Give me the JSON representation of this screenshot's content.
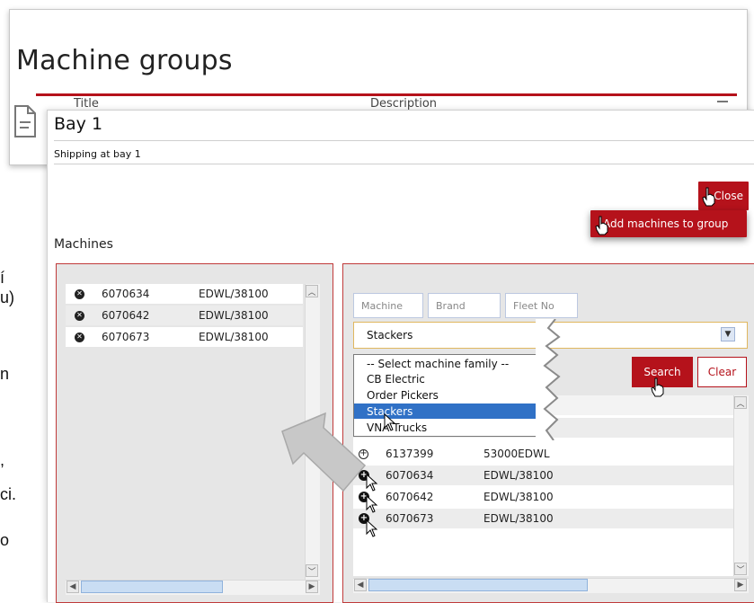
{
  "background_window": {
    "title": "Machine groups",
    "columns": [
      "Title",
      "Description"
    ]
  },
  "edge_fragments": [
    "í",
    "u)",
    "n",
    ",",
    "ci.",
    "o"
  ],
  "dialog": {
    "title": "Bay 1",
    "subtitle": "Shipping at bay 1",
    "close_label": "Close",
    "add_machines_label": "Add machines to group",
    "section_label": "Machines"
  },
  "left_list": {
    "rows": [
      {
        "number": "6070634",
        "model": "EDWL/38100"
      },
      {
        "number": "6070642",
        "model": "EDWL/38100"
      },
      {
        "number": "6070673",
        "model": "EDWL/38100"
      }
    ]
  },
  "filters": {
    "machine_placeholder": "Machine",
    "brand_placeholder": "Brand",
    "fleet_placeholder": "Fleet No"
  },
  "family_select": {
    "selected": "Stackers",
    "options": [
      "-- Select machine family --",
      "CB Electric",
      "Order Pickers",
      "Stackers",
      "VNA Trucks"
    ],
    "highlighted_index": 3
  },
  "actions": {
    "search_label": "Search",
    "clear_label": "Clear"
  },
  "results": {
    "rows": [
      {
        "number": "6137399",
        "model": "53000EDWL"
      },
      {
        "number": "6070634",
        "model": "EDWL/38100"
      },
      {
        "number": "6070642",
        "model": "EDWL/38100"
      },
      {
        "number": "6070673",
        "model": "EDWL/38100"
      }
    ]
  },
  "colors": {
    "accent": "#b5121b",
    "selected_option": "#3071c6",
    "panel_bg": "#e6e6e6"
  },
  "icons": {
    "remove": "x-circle-icon",
    "add": "plus-circle-icon",
    "dropdown": "chevron-down-icon",
    "document": "document-icon",
    "hand_cursor": "hand-cursor-icon",
    "arrow_cursor": "arrow-cursor-icon",
    "callout_arrow": "callout-arrow-icon"
  }
}
